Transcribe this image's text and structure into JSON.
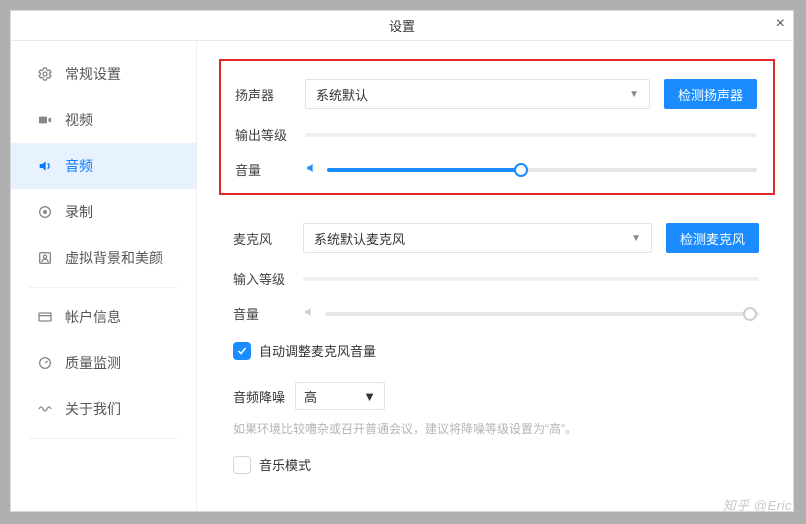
{
  "window": {
    "title": "设置"
  },
  "sidebar": {
    "items": [
      {
        "label": "常规设置",
        "icon": "gear-icon"
      },
      {
        "label": "视频",
        "icon": "video-icon"
      },
      {
        "label": "音频",
        "icon": "audio-icon",
        "active": true
      },
      {
        "label": "录制",
        "icon": "record-icon"
      },
      {
        "label": "虚拟背景和美颜",
        "icon": "portrait-icon"
      },
      {
        "label": "帐户信息",
        "icon": "card-icon"
      },
      {
        "label": "质量监测",
        "icon": "gauge-icon"
      },
      {
        "label": "关于我们",
        "icon": "wave-icon"
      }
    ]
  },
  "speaker": {
    "label": "扬声器",
    "selected": "系统默认",
    "test_button": "检测扬声器",
    "output_level_label": "输出等级",
    "volume_label": "音量",
    "volume_percent": 45
  },
  "mic": {
    "label": "麦克风",
    "selected": "系统默认麦克风",
    "test_button": "检测麦克风",
    "input_level_label": "输入等级",
    "volume_label": "音量",
    "volume_percent": 98
  },
  "auto_adjust": {
    "checked": true,
    "label": "自动调整麦克风音量"
  },
  "noise": {
    "label": "音频降噪",
    "selected": "高",
    "hint": "如果环境比较嘈杂或召开普通会议，建议将降噪等级设置为“高”。"
  },
  "music_mode": {
    "checked": false,
    "label": "音乐模式"
  },
  "watermark": "知乎 @Eric"
}
